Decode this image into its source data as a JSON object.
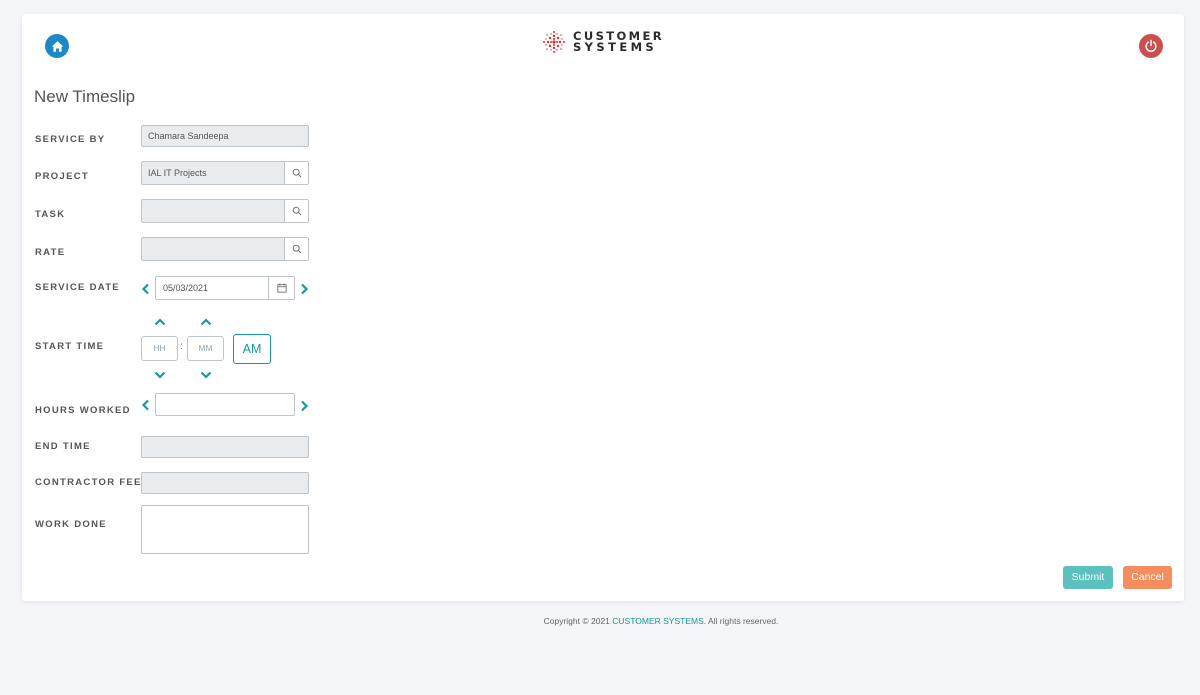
{
  "header": {
    "logo_line1": "CUSTOMER",
    "logo_line2": "SYSTEMS",
    "home_icon": "home-icon",
    "power_icon": "power-icon"
  },
  "page_title": "New Timeslip",
  "form": {
    "service_by": {
      "label": "SERVICE BY",
      "value": "Chamara Sandeepa"
    },
    "project": {
      "label": "PROJECT",
      "value": "IAL IT Projects"
    },
    "task": {
      "label": "TASK",
      "value": ""
    },
    "rate": {
      "label": "RATE",
      "value": ""
    },
    "service_date": {
      "label": "SERVICE DATE",
      "value": "05/03/2021"
    },
    "start_time": {
      "label": "START TIME",
      "hour_placeholder": "HH",
      "minute_placeholder": "MM",
      "separator": ":",
      "period": "AM"
    },
    "hours_worked": {
      "label": "HOURS WORKED",
      "value": ""
    },
    "end_time": {
      "label": "END TIME",
      "value": ""
    },
    "contractor_fee": {
      "label": "CONTRACTOR FEE",
      "value": ""
    },
    "work_done": {
      "label": "WORK DONE",
      "value": ""
    }
  },
  "actions": {
    "submit": "Submit",
    "cancel": "Cancel"
  },
  "footer": {
    "prefix": "Copyright © 2021 ",
    "brand": "CUSTOMER SYSTEMS",
    "suffix": ". All rights reserved."
  },
  "colors": {
    "accent": "#18999a",
    "home": "#1e88c7",
    "power": "#c9504e",
    "submit": "#5bc0be",
    "cancel": "#f68d5c",
    "logo_red": "#e0312e"
  }
}
